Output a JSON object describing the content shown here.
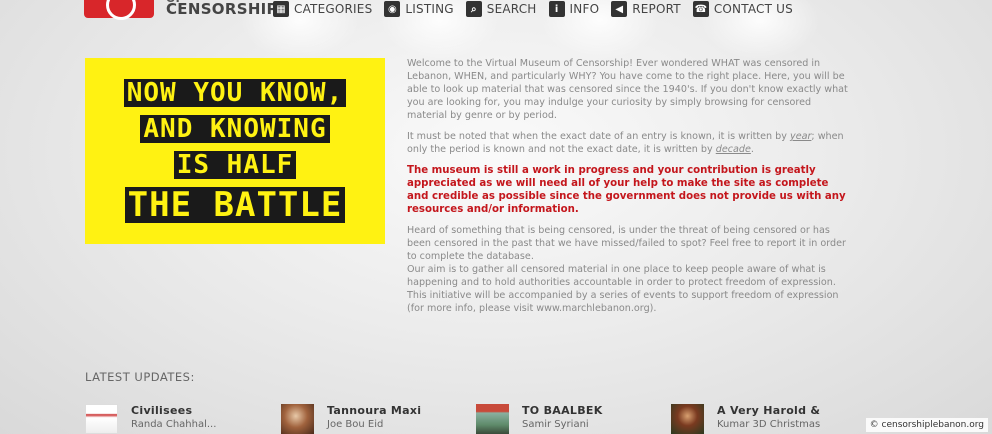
{
  "logo": {
    "of": "OF",
    "name": "CENSORSHIP"
  },
  "nav": [
    {
      "label": "CATEGORIES",
      "icon": "grid-icon"
    },
    {
      "label": "LISTING",
      "icon": "listing-icon"
    },
    {
      "label": "SEARCH",
      "icon": "search-icon"
    },
    {
      "label": "INFO",
      "icon": "info-icon"
    },
    {
      "label": "REPORT",
      "icon": "megaphone-icon"
    },
    {
      "label": "CONTACT US",
      "icon": "phone-icon"
    }
  ],
  "banner": {
    "line1": "NOW YOU KNOW,",
    "line2": "AND KNOWING",
    "line3": "IS HALF",
    "line4": "THE BATTLE"
  },
  "intro": {
    "p1": "Welcome to the Virtual Museum of Censorship! Ever wondered WHAT was censored in Lebanon, WHEN, and particularly WHY? You have come to the right place. Here, you will be able to look up material that was censored since the 1940's. If you don't know exactly what you are looking for, you may indulge your curiosity by simply browsing for censored material by genre or by period.",
    "p2a": "It must be noted that when the exact date of an entry is known, it is written by ",
    "p2_year": "year",
    "p2b": "; when only the period is known and not the exact date, it is written by ",
    "p2_decade": "decade",
    "p2c": ".",
    "red": "The museum is still a work in progress and your contribution is greatly appreciated as we will need all of your help to make the site as complete and credible as possible since the government does not provide us with any resources and/or information.",
    "p3": "Heard of something that is being censored, is under the threat of being censored or has been censored in the past that we have missed/failed to spot? Feel free to report it in order to complete the database.",
    "p4": "Our aim is to gather all censored material in one place to keep people aware of what is happening and to hold authorities accountable in order to protect freedom of expression.",
    "p5": "This initiative will be accompanied by a series of events to support freedom of expression (for more info, please visit www.marchlebanon.org)."
  },
  "updates": {
    "title": "LATEST UPDATES:",
    "items": [
      {
        "title": "Civilisees",
        "sub": "Randa Chahhal..."
      },
      {
        "title": "Tannoura Maxi",
        "sub": "Joe Bou Eid"
      },
      {
        "title": "TO BAALBEK",
        "sub": "Samir Syriani"
      },
      {
        "title": "A Very Harold &",
        "sub": "Kumar 3D Christmas"
      }
    ]
  },
  "credit": "© censorshiplebanon.org",
  "colors": {
    "banner": "#fff212",
    "red_notice": "#c4161c",
    "logo_red": "#d8262a"
  }
}
